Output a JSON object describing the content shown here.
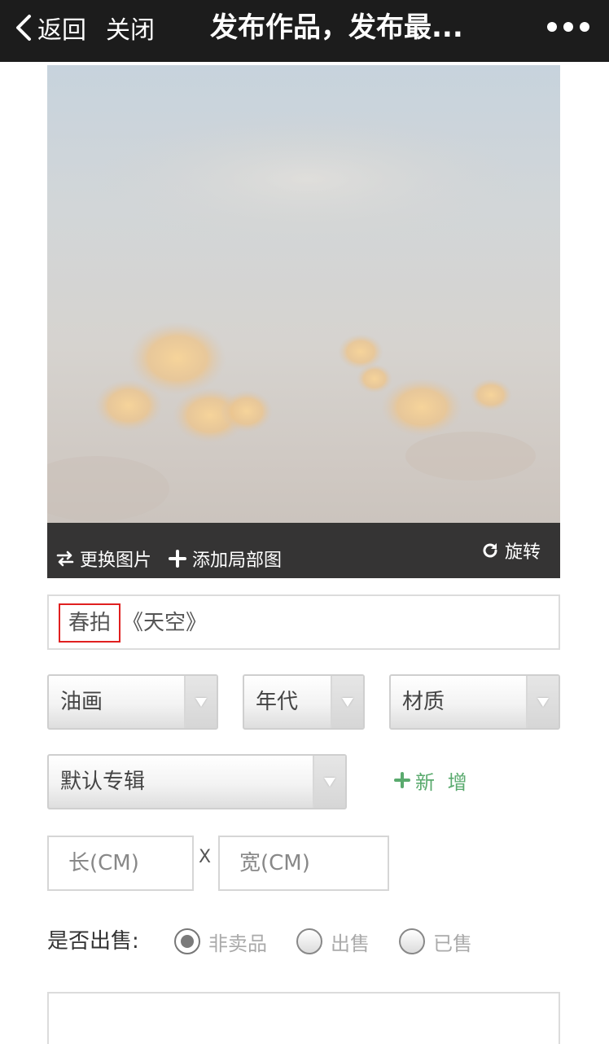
{
  "navbar": {
    "back_label": "返回",
    "close_label": "关闭",
    "title": "发布作品，发布最..."
  },
  "image_toolbar": {
    "replace_label": "更换图片",
    "add_detail_label": "添加局部图",
    "rotate_label": "旋转"
  },
  "title_field": {
    "tag": "春拍",
    "value": "《天空》"
  },
  "selects": {
    "type": "油画",
    "year": "年代",
    "material": "材质",
    "album": "默认专辑"
  },
  "add_new_label": "新 增",
  "size": {
    "length_placeholder": "长(CM)",
    "separator": "X",
    "width_placeholder": "宽(CM)"
  },
  "sale": {
    "label": "是否出售:",
    "options": [
      {
        "label": "非卖品",
        "checked": true
      },
      {
        "label": "出售",
        "checked": false
      },
      {
        "label": "已售",
        "checked": false
      }
    ]
  }
}
